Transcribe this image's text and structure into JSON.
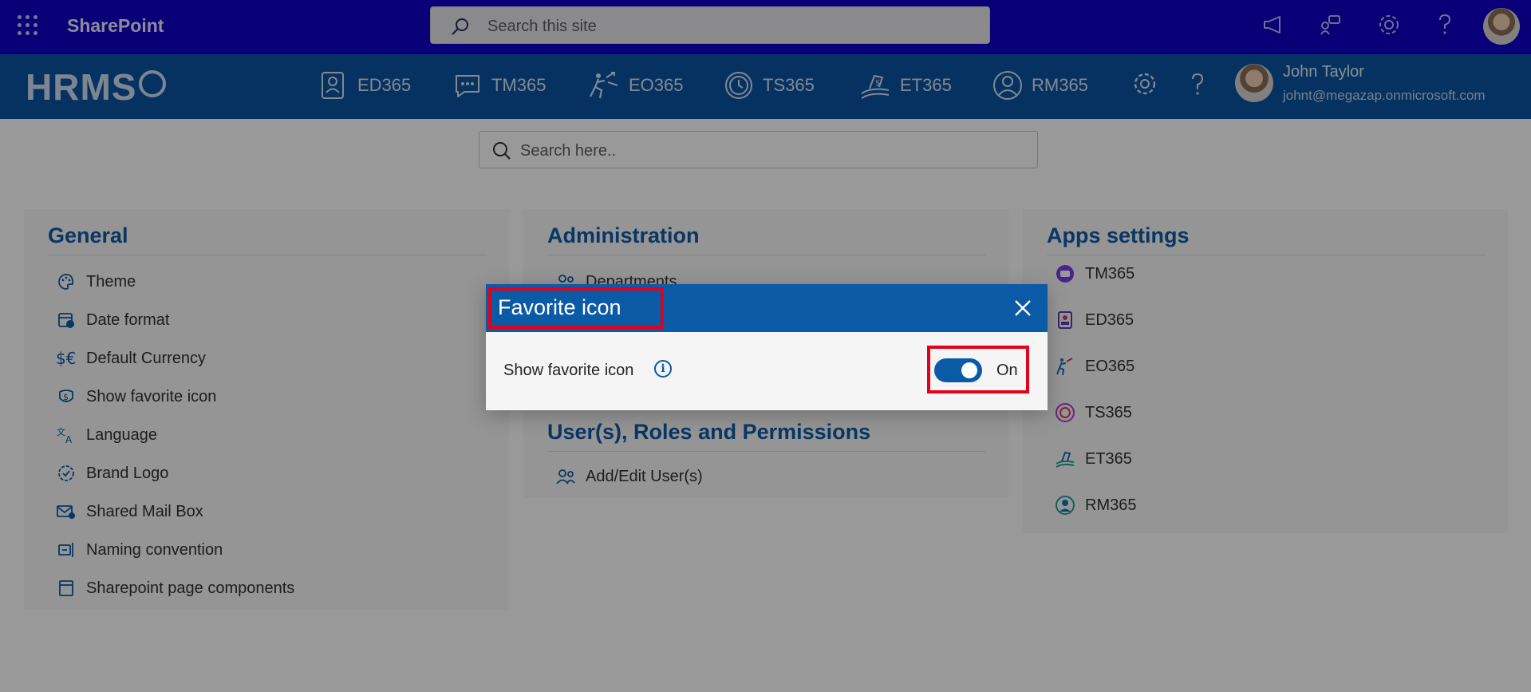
{
  "suitebar": {
    "title": "SharePoint",
    "search_placeholder": "Search this site"
  },
  "appbar": {
    "logo": "HRMS",
    "apps": [
      "ED365",
      "TM365",
      "EO365",
      "TS365",
      "ET365",
      "RM365"
    ],
    "user": {
      "name": "John Taylor",
      "email": "johnt@megazap.onmicrosoft.com"
    }
  },
  "main": {
    "search_placeholder": "Search here..",
    "general": {
      "title": "General",
      "items": [
        "Theme",
        "Date format",
        "Default Currency",
        "Show favorite icon",
        "Language",
        "Brand Logo",
        "Shared Mail Box",
        "Naming convention",
        "Sharepoint page components"
      ]
    },
    "administration": {
      "title": "Administration",
      "items": [
        "Departments"
      ]
    },
    "users": {
      "title": "User(s), Roles and Permissions",
      "items": [
        "Add/Edit User(s)"
      ]
    },
    "apps_settings": {
      "title": "Apps settings",
      "items": [
        "TM365",
        "ED365",
        "EO365",
        "TS365",
        "ET365",
        "RM365"
      ]
    }
  },
  "dialog": {
    "title": "Favorite icon",
    "setting_label": "Show favorite icon",
    "toggle_state": "On",
    "toggle_on": true
  },
  "colors": {
    "suitebar": "#1000c8",
    "appbar": "#0b54a3",
    "accent": "#0b5aa6",
    "highlight": "#e3001b"
  }
}
